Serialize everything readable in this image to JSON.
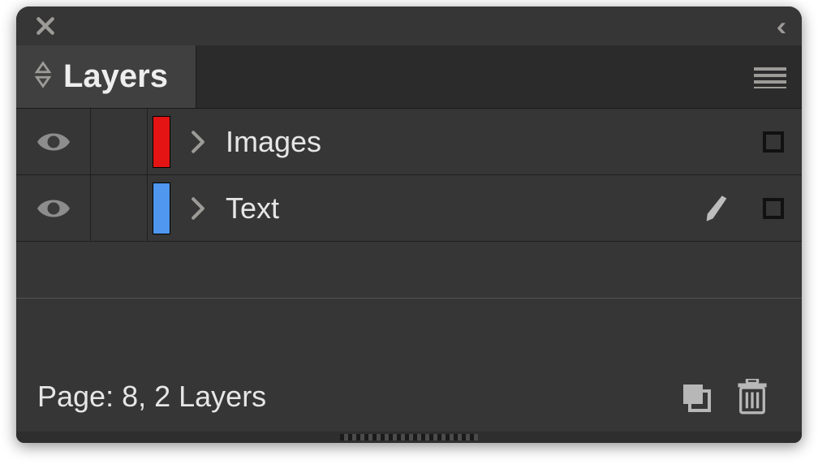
{
  "panel": {
    "title": "Layers"
  },
  "layers": [
    {
      "name": "Images",
      "color": "#e41414",
      "hasPen": false
    },
    {
      "name": "Text",
      "color": "#4f97ef",
      "hasPen": true
    }
  ],
  "footer": {
    "status": "Page: 8, 2 Layers"
  }
}
